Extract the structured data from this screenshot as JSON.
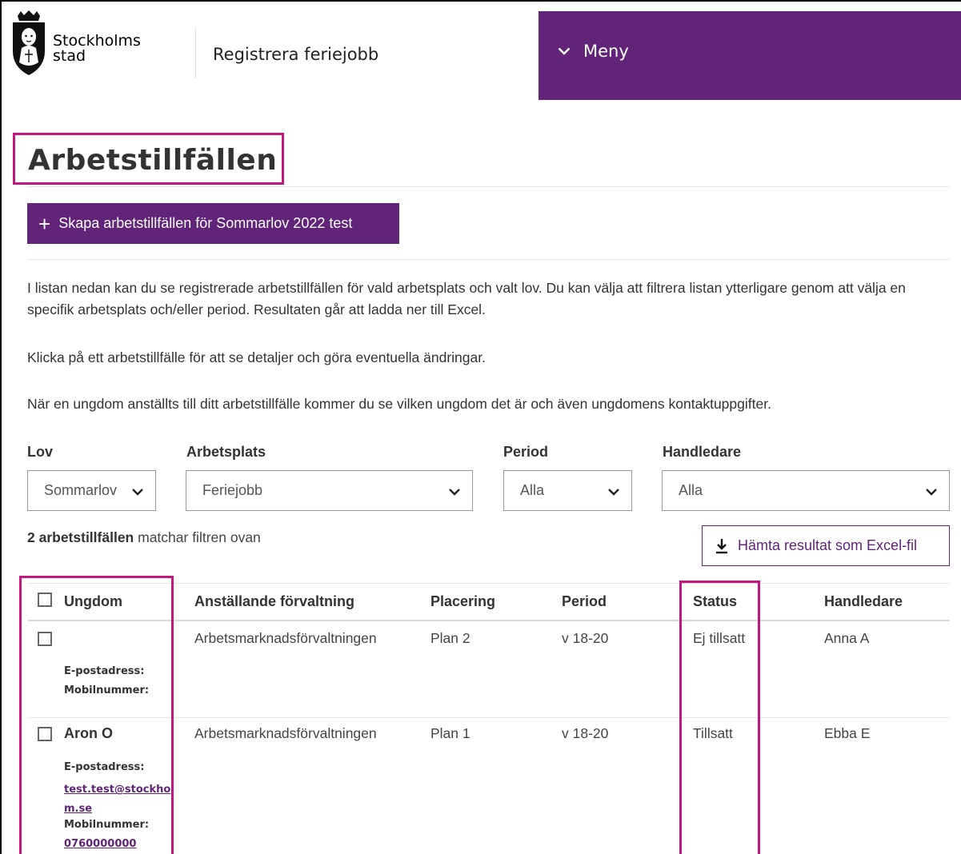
{
  "header": {
    "logo_text_line1": "Stockholms",
    "logo_text_line2": "stad",
    "site_title": "Registrera feriejobb",
    "menu_label": "Meny",
    "menu_color": "#612478"
  },
  "page": {
    "title": "Arbetstillfällen",
    "create_button_label": "Skapa arbetstillfällen för Sommarlov 2022 test",
    "intro_paragraph_1": "I listan nedan kan du se registrerade arbetstillfällen för vald arbetsplats och valt lov. Du kan välja att filtrera listan ytterligare genom att välja en specifik arbetsplats och/eller period. Resultaten går att ladda ner till Excel.",
    "intro_paragraph_2": "Klicka på ett arbetstillfälle för att se detaljer och göra eventuella ändringar.",
    "intro_paragraph_3": "När en ungdom anställts till ditt arbetstillfälle kommer du se vilken ungdom det är och även ungdomens kontaktuppgifter."
  },
  "filters": {
    "lov": {
      "label": "Lov",
      "value": "Sommarlov"
    },
    "arbetsplats": {
      "label": "Arbetsplats",
      "value": "Feriejobb"
    },
    "period": {
      "label": "Period",
      "value": "Alla"
    },
    "handledare": {
      "label": "Handledare",
      "value": "Alla"
    }
  },
  "results": {
    "count_bold": "2 arbetstillfällen",
    "count_rest": " matchar filtren ovan",
    "excel_button_label": "Hämta resultat som Excel-fil"
  },
  "table": {
    "headers": [
      "Ungdom",
      "Anställande förvaltning",
      "Placering",
      "Period",
      "Status",
      "Handledare"
    ],
    "email_label": "E-postadress:",
    "phone_label": "Mobilnummer:",
    "rows": [
      {
        "name": "",
        "forvaltning": "Arbetsmarknadsförvaltningen",
        "placering": "Plan 2",
        "period": "v 18-20",
        "status": "Ej tillsatt",
        "handledare": "Anna A",
        "email_line1": "",
        "email_line2": "",
        "phone": ""
      },
      {
        "name": "Aron O",
        "forvaltning": "Arbetsmarknadsförvaltningen",
        "placering": "Plan 1",
        "period": "v 18-20",
        "status": "Tillsatt",
        "handledare": "Ebba E",
        "email_line1": "test.test@stockho",
        "email_line2": "m.se",
        "phone": "0760000000"
      }
    ]
  },
  "highlight_color": "#c3177d"
}
